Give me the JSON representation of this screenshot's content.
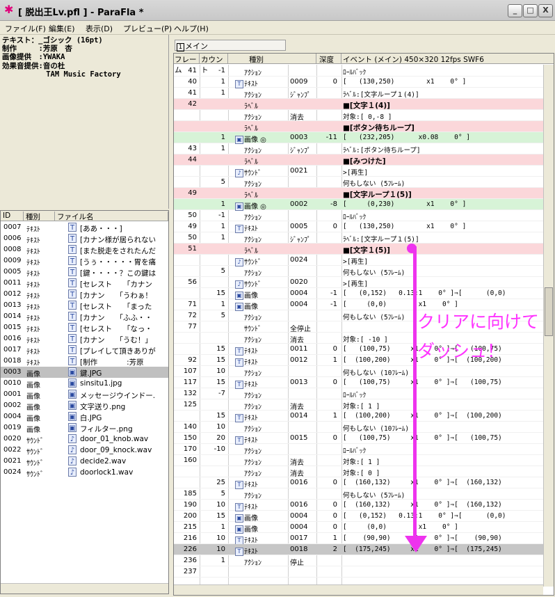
{
  "window": {
    "title": "[ 脱出王Lv.pfl ] - ParaFla *",
    "minimize": "_",
    "maximize": "□",
    "close": "X",
    "icon": "star-icon"
  },
  "menu": [
    "ファイル(F)",
    "編集(E)",
    "表示(D)",
    "プレビュー(P)",
    "ヘルプ(H)"
  ],
  "properties": {
    "text": "テキスト：_ゴシック (16pt)\n制作　　　:芳原　杏\n画像提供　:YWAKA\n効果音提供:音の杜\n          TAM Music Factory"
  },
  "file_list": {
    "headers": [
      "ID",
      "種別",
      "ファイル名"
    ],
    "rows": [
      {
        "id": "0007",
        "type": "ﾃｷｽﾄ",
        "name": "[ああ・・・]",
        "icon": "text-icon"
      },
      {
        "id": "0006",
        "type": "ﾃｷｽﾄ",
        "name": "[カナン様が居られない",
        "icon": "text-icon"
      },
      {
        "id": "0008",
        "type": "ﾃｷｽﾄ",
        "name": "[また脱走をされたんだ",
        "icon": "text-icon"
      },
      {
        "id": "0009",
        "type": "ﾃｷｽﾄ",
        "name": "[うぅ・・・・・胃を痛",
        "icon": "text-icon"
      },
      {
        "id": "0005",
        "type": "ﾃｷｽﾄ",
        "name": "[鍵・・・・？この鍵は",
        "icon": "text-icon"
      },
      {
        "id": "0011",
        "type": "ﾃｷｽﾄ",
        "name": "[セレスト　　「カナン",
        "icon": "text-icon"
      },
      {
        "id": "0012",
        "type": "ﾃｷｽﾄ",
        "name": "[カナン　　「うわぁ！",
        "icon": "text-icon"
      },
      {
        "id": "0013",
        "type": "ﾃｷｽﾄ",
        "name": "[セレスト　　「まった",
        "icon": "text-icon"
      },
      {
        "id": "0014",
        "type": "ﾃｷｽﾄ",
        "name": "[カナン　　「ふふ・・",
        "icon": "text-icon"
      },
      {
        "id": "0015",
        "type": "ﾃｷｽﾄ",
        "name": "[セレスト　　「なっ・",
        "icon": "text-icon"
      },
      {
        "id": "0016",
        "type": "ﾃｷｽﾄ",
        "name": "[カナン　　「うむ！」",
        "icon": "text-icon"
      },
      {
        "id": "0017",
        "type": "ﾃｷｽﾄ",
        "name": "[プレイして頂きありが",
        "icon": "text-icon"
      },
      {
        "id": "0018",
        "type": "ﾃｷｽﾄ",
        "name": "[制作　　　　:芳原",
        "icon": "text-icon"
      },
      {
        "id": "0003",
        "type": "画像",
        "name": "鍵.JPG",
        "icon": "image-icon",
        "selected": true
      },
      {
        "id": "0010",
        "type": "画像",
        "name": "sinsitu1.jpg",
        "icon": "image-icon"
      },
      {
        "id": "0001",
        "type": "画像",
        "name": "メッセージウインドー.",
        "icon": "image-icon"
      },
      {
        "id": "0002",
        "type": "画像",
        "name": "文字送り.png",
        "icon": "image-icon"
      },
      {
        "id": "0004",
        "type": "画像",
        "name": "白.JPG",
        "icon": "image-icon"
      },
      {
        "id": "0019",
        "type": "画像",
        "name": "フィルター.png",
        "icon": "image-icon"
      },
      {
        "id": "0020",
        "type": "ｻｳﾝﾄﾞ",
        "name": "door_01_knob.wav",
        "icon": "sound-icon"
      },
      {
        "id": "0022",
        "type": "ｻｳﾝﾄﾞ",
        "name": "door_09_knock.wav",
        "icon": "sound-icon"
      },
      {
        "id": "0021",
        "type": "ｻｳﾝﾄﾞ",
        "name": "decide2.wav",
        "icon": "sound-icon"
      },
      {
        "id": "0024",
        "type": "ｻｳﾝﾄﾞ",
        "name": "doorlock1.wav",
        "icon": "sound-icon"
      }
    ]
  },
  "tab": {
    "num": "1",
    "label": "メイン"
  },
  "timeline": {
    "headers": {
      "frame": "フレーム",
      "count": "カウント",
      "type": "種別",
      "depth": "深度",
      "event": "イベント (メイン) 450×320 12fps SWF6"
    },
    "rows": [
      {
        "frame": "41",
        "count": "-1",
        "type": "ｱｸｼｮﾝ",
        "obj": "",
        "depth": "",
        "event": "ﾛｰﾙﾊﾞｯｸ"
      },
      {
        "frame": "40",
        "count": "1",
        "type": "ﾃｷｽﾄ",
        "icon": "T",
        "obj": "0009",
        "depth": "0",
        "event": "[   (130,250)        x1    0° ]"
      },
      {
        "frame": "41",
        "count": "1",
        "type": "ｱｸｼｮﾝ",
        "obj": "ｼﾞｬﾝﾌﾟ",
        "depth": "",
        "event": "ﾗﾍﾞﾙ:[文字ループ１(4)]"
      },
      {
        "frame": "42",
        "count": "",
        "type": "ﾗﾍﾞﾙ",
        "obj": "",
        "depth": "",
        "event": "■[文字１(4)]",
        "style": "pink",
        "bold": true
      },
      {
        "frame": "",
        "count": "",
        "type": "ｱｸｼｮﾝ",
        "obj": "消去",
        "depth": "",
        "event": "対象:[ 0,-8 ]"
      },
      {
        "frame": "",
        "count": "",
        "type": "ﾗﾍﾞﾙ",
        "obj": "",
        "depth": "",
        "event": "■[ボタン待ちループ]",
        "style": "pink",
        "bold": true
      },
      {
        "frame": "",
        "count": "1",
        "type": "画像  ◎",
        "icon": "▣",
        "obj": "0003",
        "depth": "-11",
        "event": "[   (232,205)      x0.08    0° ]",
        "style": "green"
      },
      {
        "frame": "43",
        "count": "1",
        "type": "ｱｸｼｮﾝ",
        "obj": "ｼﾞｬﾝﾌﾟ",
        "depth": "",
        "event": "ﾗﾍﾞﾙ:[ボタン待ちループ]"
      },
      {
        "frame": "44",
        "count": "",
        "type": "ﾗﾍﾞﾙ",
        "obj": "",
        "depth": "",
        "event": "■[みつけた]",
        "style": "pink",
        "bold": true
      },
      {
        "frame": "",
        "count": "",
        "type": "ｻｳﾝﾄﾞ",
        "icon": "♪",
        "obj": "0021",
        "depth": "",
        "event": ">[再生]"
      },
      {
        "frame": "",
        "count": "5",
        "type": "ｱｸｼｮﾝ",
        "obj": "",
        "depth": "",
        "event": "何もしない (5ﾌﾚｰﾑ)"
      },
      {
        "frame": "49",
        "count": "",
        "type": "ﾗﾍﾞﾙ",
        "obj": "",
        "depth": "",
        "event": "■[文字ループ１(5)]",
        "style": "pink",
        "bold": true
      },
      {
        "frame": "",
        "count": "1",
        "type": "画像  ◎",
        "icon": "▣",
        "obj": "0002",
        "depth": "-8",
        "event": "[     (0,230)        x1    0° ]",
        "style": "green"
      },
      {
        "frame": "50",
        "count": "-1",
        "type": "ｱｸｼｮﾝ",
        "obj": "",
        "depth": "",
        "event": "ﾛｰﾙﾊﾞｯｸ"
      },
      {
        "frame": "49",
        "count": "1",
        "type": "ﾃｷｽﾄ",
        "icon": "T",
        "obj": "0005",
        "depth": "0",
        "event": "[   (130,250)        x1    0° ]"
      },
      {
        "frame": "50",
        "count": "1",
        "type": "ｱｸｼｮﾝ",
        "obj": "ｼﾞｬﾝﾌﾟ",
        "depth": "",
        "event": "ﾗﾍﾞﾙ:[文字ループ１(5)]"
      },
      {
        "frame": "51",
        "count": "",
        "type": "ﾗﾍﾞﾙ",
        "obj": "",
        "depth": "",
        "event": "■[文字１(5)]",
        "style": "pink",
        "bold": true
      },
      {
        "frame": "",
        "count": "",
        "type": "ｻｳﾝﾄﾞ",
        "icon": "♪",
        "obj": "0024",
        "depth": "",
        "event": ">[再生]"
      },
      {
        "frame": "",
        "count": "5",
        "type": "ｱｸｼｮﾝ",
        "obj": "",
        "depth": "",
        "event": "何もしない (5ﾌﾚｰﾑ)"
      },
      {
        "frame": "56",
        "count": "",
        "type": "ｻｳﾝﾄﾞ",
        "icon": "♪",
        "obj": "0020",
        "depth": "",
        "event": ">[再生]"
      },
      {
        "frame": "",
        "count": "15",
        "type": "画像",
        "icon": "▣",
        "obj": "0004",
        "depth": "-1",
        "event": "[   (0,152)   0.13:1    0° ]⇒[      (0,0)"
      },
      {
        "frame": "71",
        "count": "1",
        "type": "画像",
        "icon": "▣",
        "obj": "0004",
        "depth": "-1",
        "event": "[     (0,0)        x1    0° ]"
      },
      {
        "frame": "72",
        "count": "5",
        "type": "ｱｸｼｮﾝ",
        "obj": "",
        "depth": "",
        "event": "何もしない (5ﾌﾚｰﾑ)"
      },
      {
        "frame": "77",
        "count": "",
        "type": "ｻｳﾝﾄﾞ",
        "obj": "全停止",
        "depth": "",
        "event": ""
      },
      {
        "frame": "",
        "count": "",
        "type": "ｱｸｼｮﾝ",
        "obj": "消去",
        "depth": "",
        "event": "対象:[ -10 ]"
      },
      {
        "frame": "",
        "count": "15",
        "type": "ﾃｷｽﾄ",
        "icon": "T",
        "obj": "0011",
        "depth": "0",
        "event": "[   (100,75)     x1    0° ]⇒[   (100,75)"
      },
      {
        "frame": "92",
        "count": "15",
        "type": "ﾃｷｽﾄ",
        "icon": "T",
        "obj": "0012",
        "depth": "1",
        "event": "[  (100,200)     x1    0° ]⇒[  (100,200)"
      },
      {
        "frame": "107",
        "count": "10",
        "type": "ｱｸｼｮﾝ",
        "obj": "",
        "depth": "",
        "event": "何もしない (10ﾌﾚｰﾑ)"
      },
      {
        "frame": "117",
        "count": "15",
        "type": "ﾃｷｽﾄ",
        "icon": "T",
        "obj": "0013",
        "depth": "0",
        "event": "[   (100,75)     x1    0° ]⇒[   (100,75)"
      },
      {
        "frame": "132",
        "count": "-7",
        "type": "ｱｸｼｮﾝ",
        "obj": "",
        "depth": "",
        "event": "ﾛｰﾙﾊﾞｯｸ"
      },
      {
        "frame": "125",
        "count": "",
        "type": "ｱｸｼｮﾝ",
        "obj": "消去",
        "depth": "",
        "event": "対象:[ 1 ]"
      },
      {
        "frame": "",
        "count": "15",
        "type": "ﾃｷｽﾄ",
        "icon": "T",
        "obj": "0014",
        "depth": "1",
        "event": "[  (100,200)     x1    0° ]⇒[  (100,200)"
      },
      {
        "frame": "140",
        "count": "10",
        "type": "ｱｸｼｮﾝ",
        "obj": "",
        "depth": "",
        "event": "何もしない (10ﾌﾚｰﾑ)"
      },
      {
        "frame": "150",
        "count": "20",
        "type": "ﾃｷｽﾄ",
        "icon": "T",
        "obj": "0015",
        "depth": "0",
        "event": "[   (100,75)     x1    0° ]⇒[   (100,75)"
      },
      {
        "frame": "170",
        "count": "-10",
        "type": "ｱｸｼｮﾝ",
        "obj": "",
        "depth": "",
        "event": "ﾛｰﾙﾊﾞｯｸ"
      },
      {
        "frame": "160",
        "count": "",
        "type": "ｱｸｼｮﾝ",
        "obj": "消去",
        "depth": "",
        "event": "対象:[ 1 ]"
      },
      {
        "frame": "",
        "count": "",
        "type": "ｱｸｼｮﾝ",
        "obj": "消去",
        "depth": "",
        "event": "対象:[ 0 ]"
      },
      {
        "frame": "",
        "count": "25",
        "type": "ﾃｷｽﾄ",
        "icon": "T",
        "obj": "0016",
        "depth": "0",
        "event": "[  (160,132)     x1    0° ]⇒[  (160,132)"
      },
      {
        "frame": "185",
        "count": "5",
        "type": "ｱｸｼｮﾝ",
        "obj": "",
        "depth": "",
        "event": "何もしない (5ﾌﾚｰﾑ)"
      },
      {
        "frame": "190",
        "count": "10",
        "type": "ﾃｷｽﾄ",
        "icon": "T",
        "obj": "0016",
        "depth": "0",
        "event": "[  (160,132)     x1    0° ]⇒[  (160,132)"
      },
      {
        "frame": "200",
        "count": "15",
        "type": "画像",
        "icon": "▣",
        "obj": "0004",
        "depth": "0",
        "event": "[   (0,152)   0.13:1    0° ]⇒[      (0,0)"
      },
      {
        "frame": "215",
        "count": "1",
        "type": "画像",
        "icon": "▣",
        "obj": "0004",
        "depth": "0",
        "event": "[     (0,0)        x1    0° ]"
      },
      {
        "frame": "216",
        "count": "10",
        "type": "ﾃｷｽﾄ",
        "icon": "T",
        "obj": "0017",
        "depth": "1",
        "event": "[    (90,90)     x1    0° ]⇒[    (90,90)"
      },
      {
        "frame": "226",
        "count": "10",
        "type": "ﾃｷｽﾄ",
        "icon": "T",
        "obj": "0018",
        "depth": "2",
        "event": "[  (175,245)     x1    0° ]⇒[  (175,245)",
        "style": "sel"
      },
      {
        "frame": "236",
        "count": "1",
        "type": "ｱｸｼｮﾝ",
        "obj": "停止",
        "depth": "",
        "event": ""
      },
      {
        "frame": "237",
        "count": "",
        "type": "",
        "obj": "",
        "depth": "",
        "event": ""
      }
    ]
  },
  "annotation": {
    "line1": "クリアに向けて",
    "line2": "ダッシュ！",
    "color": "#ff33ff"
  }
}
